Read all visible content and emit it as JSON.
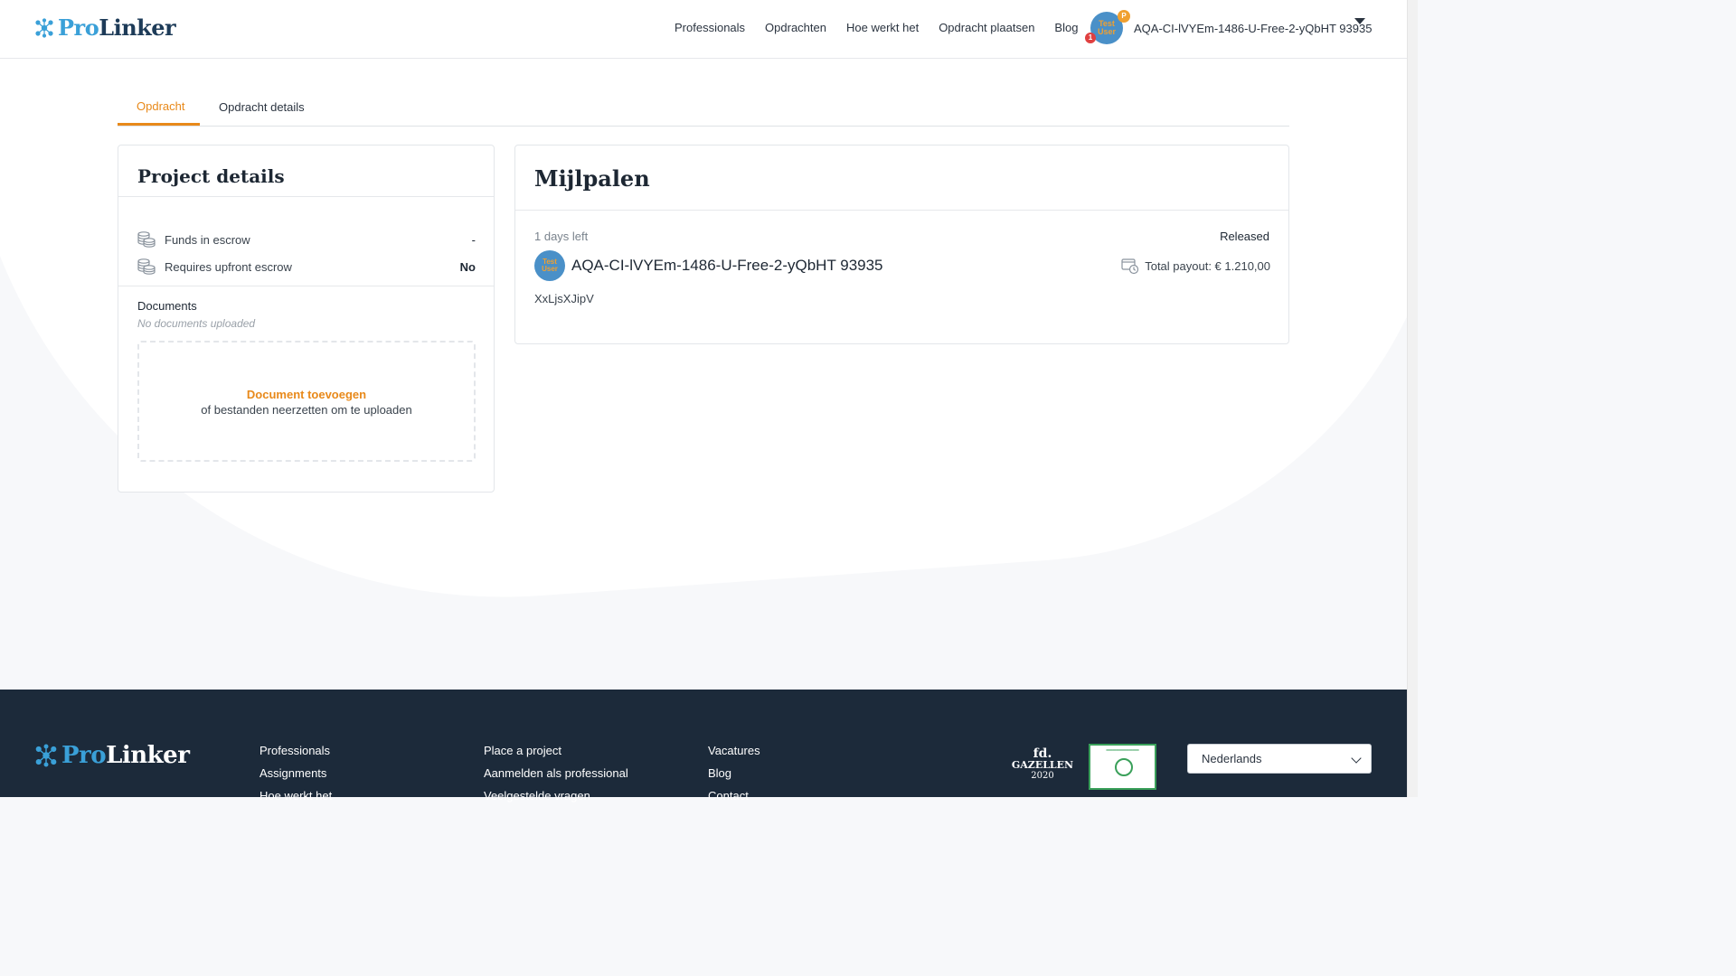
{
  "header": {
    "brand_pro": "Pro",
    "brand_linker": "Linker",
    "nav": [
      "Professionals",
      "Opdrachten",
      "Hoe werkt het",
      "Opdracht plaatsen",
      "Blog"
    ],
    "user": {
      "avatar_text": "Test User",
      "premium_badge": "P",
      "notification_count": "1",
      "name": "AQA-CI-lVYEm-1486-U-Free-2-yQbHT 93935"
    }
  },
  "tabs": [
    "Opdracht",
    "Opdracht details"
  ],
  "project_details": {
    "title": "Project details",
    "rows": [
      {
        "label": "Funds in escrow",
        "value": "-"
      },
      {
        "label": "Requires upfront escrow",
        "value": "No"
      }
    ],
    "documents_label": "Documents",
    "documents_empty": "No documents uploaded",
    "drop_link": "Document toevoegen",
    "drop_sub": "of bestanden neerzetten om te uploaden"
  },
  "milestones": {
    "title": "Mijlpalen",
    "days_left": "1 days left",
    "status": "Released",
    "avatar_text": "Test User",
    "name": "AQA-CI-lVYEm-1486-U-Free-2-yQbHT 93935",
    "payout": "Total payout: € 1.210,00",
    "description": "XxLjsXJipV"
  },
  "footer": {
    "brand_pro": "Pro",
    "brand_linker": "Linker",
    "col1": [
      "Professionals",
      "Assignments",
      "Hoe werkt het"
    ],
    "col2": [
      "Place a project",
      "Aanmelden als professional",
      "Veelgestelde vragen"
    ],
    "col3": [
      "Vacatures",
      "Blog",
      "Contact"
    ],
    "fd_badge": {
      "line1": "fd.",
      "line2": "GAZELLEN",
      "line3": "2020"
    },
    "language": "Nederlands"
  },
  "colors": {
    "accent": "#e8891a",
    "brand_blue": "#3aa0d8",
    "footer_bg": "#1c2a3a"
  }
}
